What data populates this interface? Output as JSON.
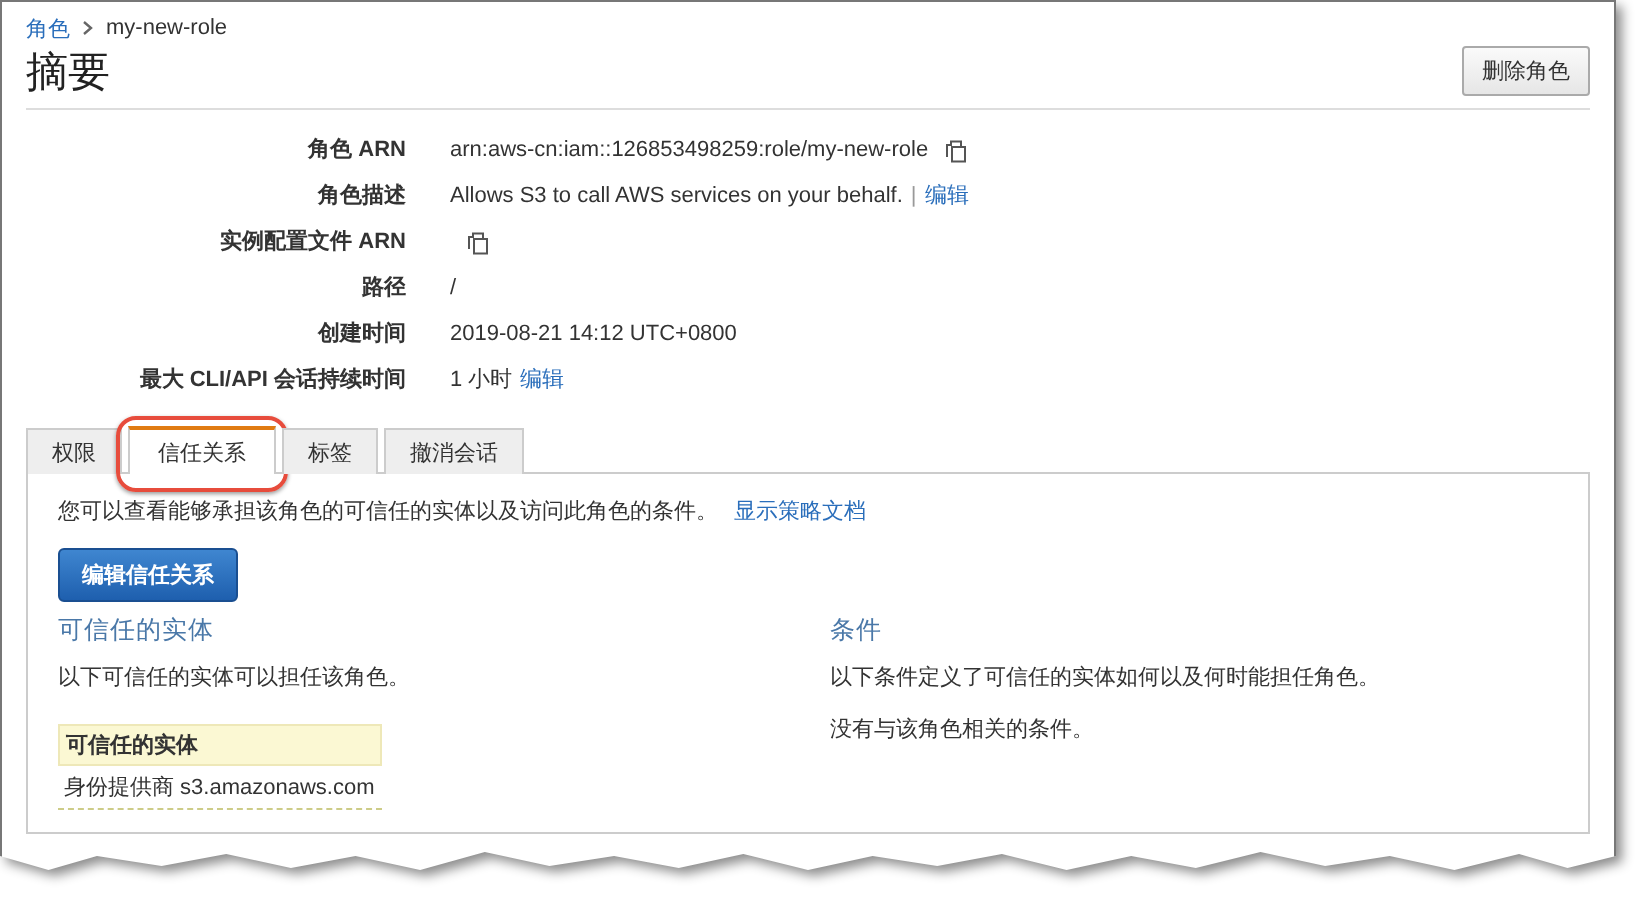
{
  "breadcrumb": [
    {
      "label": "角色",
      "link": true
    },
    {
      "label": "my-new-role",
      "link": false
    }
  ],
  "page_title": "摘要",
  "delete_button": "删除角色",
  "details": [
    {
      "label": "角色 ARN",
      "value": "arn:aws-cn:iam::126853498259:role/my-new-role",
      "copy": true
    },
    {
      "label": "角色描述",
      "value": "Allows S3 to call AWS services on your behalf.",
      "separator": "|",
      "link": "编辑",
      "copy": false
    },
    {
      "label": "实例配置文件 ARN",
      "copy": true
    },
    {
      "label": "路径",
      "value": "/",
      "copy": false
    },
    {
      "label": "创建时间",
      "value": "2019-08-21 14:12 UTC+0800",
      "copy": false
    },
    {
      "label": "最大 CLI/API 会话持续时间",
      "value": "1 小时",
      "link": "编辑",
      "copy": false
    }
  ],
  "tabs": [
    {
      "label": "权限",
      "selected": false,
      "highlighted": false
    },
    {
      "label": "信任关系",
      "selected": true,
      "highlighted": true
    },
    {
      "label": "标签",
      "selected": false,
      "highlighted": false
    },
    {
      "label": "撤消会话",
      "selected": false,
      "highlighted": false
    }
  ],
  "trust_panel": {
    "intro": "您可以查看能够承担该角色的可信任的实体以及访问此角色的条件。",
    "intro_link": "显示策略文档",
    "edit_button": "编辑信任关系",
    "entities": {
      "heading": "可信任的实体",
      "description": "以下可信任的实体可以担任该角色。",
      "table_header": "可信任的实体",
      "rows": [
        "身份提供商 s3.amazonaws.com"
      ]
    },
    "conditions": {
      "heading": "条件",
      "description": "以下条件定义了可信任的实体如何以及何时能担任角色。",
      "note": "没有与该角色相关的条件。"
    }
  }
}
